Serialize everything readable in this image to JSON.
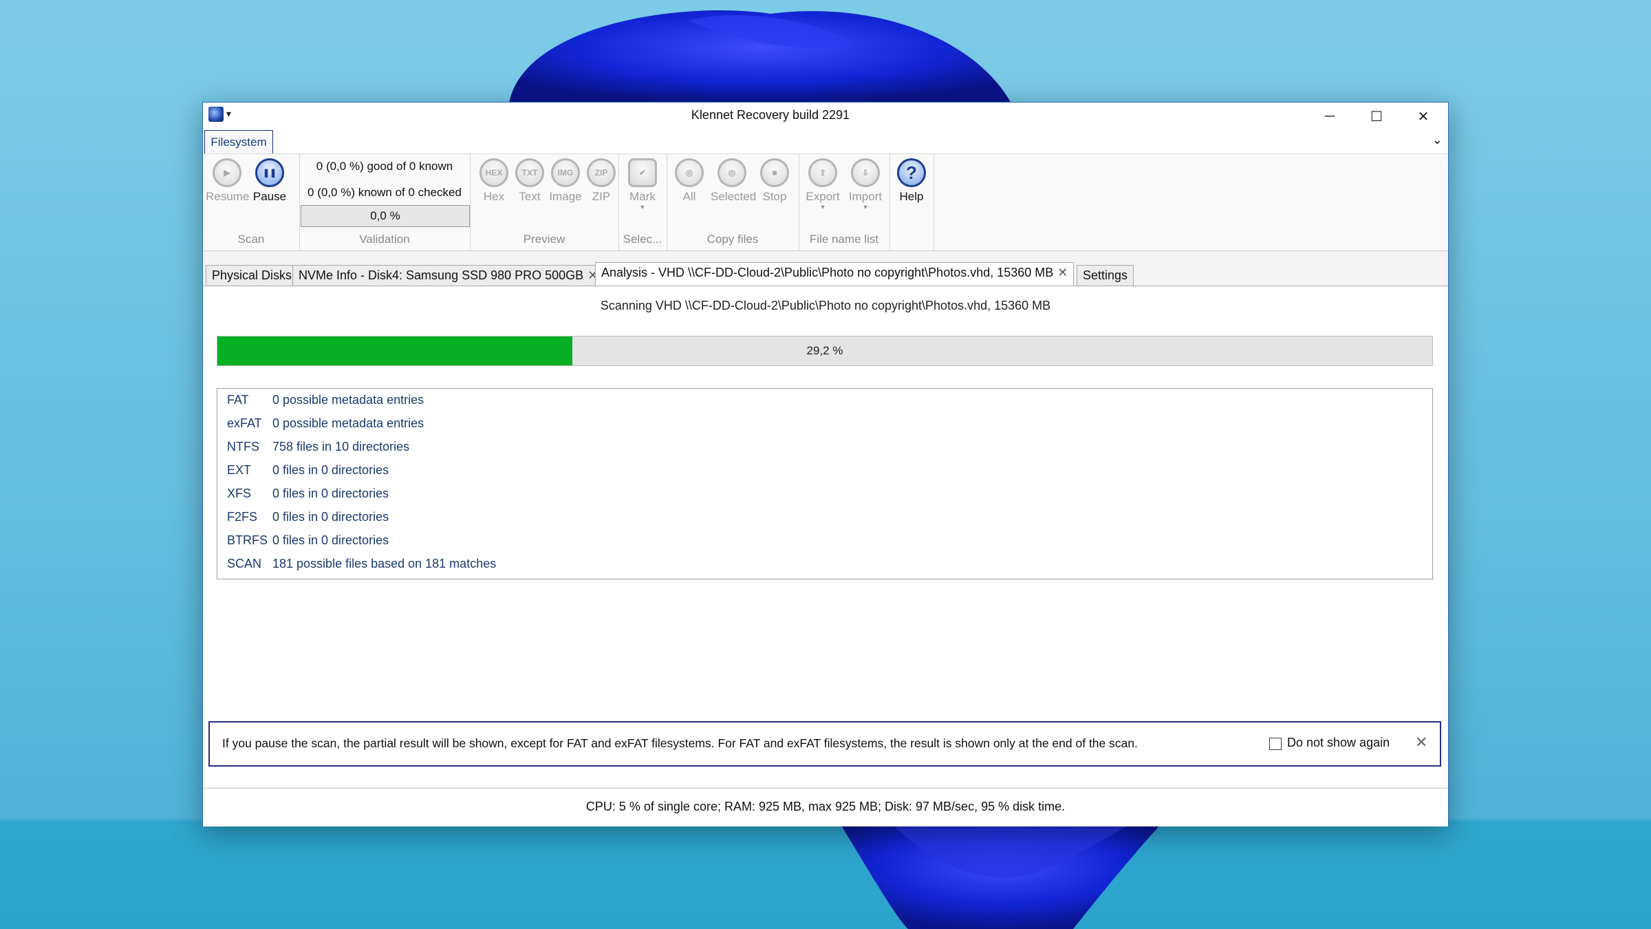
{
  "window": {
    "title": "Klennet Recovery build 2291",
    "minimize": "─",
    "maximize": "☐",
    "close": "✕",
    "quick_access": "▾"
  },
  "ribbon": {
    "tab": "Filesystem",
    "collapse_icon": "chevron-down-icon",
    "groups": {
      "scan": {
        "label": "Scan",
        "resume": "Resume",
        "pause": "Pause"
      },
      "validation": {
        "label": "Validation",
        "line1": "0 (0,0 %) good of 0 known",
        "line2": "0 (0,0 %) known of 0 checked",
        "progress_text": "0,0 %",
        "progress": 0
      },
      "preview": {
        "label": "Preview",
        "hex": "Hex",
        "hex_icon_text": "HEX",
        "text": "Text",
        "text_icon_text": "TXT",
        "image": "Image",
        "image_icon_text": "IMG",
        "zip": "ZIP",
        "zip_icon_text": "ZIP"
      },
      "select": {
        "label": "Selec...",
        "mark": "Mark"
      },
      "copy": {
        "label": "Copy files",
        "all": "All",
        "selected": "Selected",
        "stop": "Stop"
      },
      "file_name_list": {
        "label": "File name list",
        "export": "Export",
        "import": "Import"
      },
      "help": {
        "label": "Help"
      }
    }
  },
  "tabs": [
    {
      "label": "Physical Disks",
      "closable": false
    },
    {
      "label": "NVMe Info - Disk4:  Samsung SSD 980 PRO 500GB",
      "closable": true
    },
    {
      "label": "Analysis - VHD \\\\CF-DD-Cloud-2\\Public\\Photo no copyright\\Photos.vhd, 15360 MB",
      "closable": true,
      "active": true
    },
    {
      "label": "Settings",
      "closable": false
    }
  ],
  "tab_close": "✕",
  "analysis": {
    "scanning_text": "Scanning VHD \\\\CF-DD-Cloud-2\\Public\\Photo no copyright\\Photos.vhd, 15360 MB",
    "progress_text": "29,2 %",
    "progress": 0.292,
    "progress_color": "#06b025",
    "filesystems": [
      {
        "name": "FAT",
        "value": "0 possible metadata entries"
      },
      {
        "name": "exFAT",
        "value": "0 possible metadata entries"
      },
      {
        "name": "NTFS",
        "value": "758 files in 10 directories"
      },
      {
        "name": "EXT",
        "value": "0 files in 0 directories"
      },
      {
        "name": "XFS",
        "value": "0 files in 0 directories"
      },
      {
        "name": "F2FS",
        "value": "0 files in 0 directories"
      },
      {
        "name": "BTRFS",
        "value": "0 files in 0 directories"
      },
      {
        "name": "SCAN",
        "value": "181 possible files based on 181 matches"
      }
    ]
  },
  "banner": {
    "text": "If you pause the scan, the partial result will be shown, except for FAT and exFAT filesystems. For FAT and exFAT filesystems, the result is shown only at the end of the scan.",
    "checkbox_label": "Do not show again",
    "checked": false,
    "close": "✕"
  },
  "status": "CPU: 5 % of single core; RAM: 925 MB, max 925 MB; Disk: 97 MB/sec, 95 % disk time."
}
